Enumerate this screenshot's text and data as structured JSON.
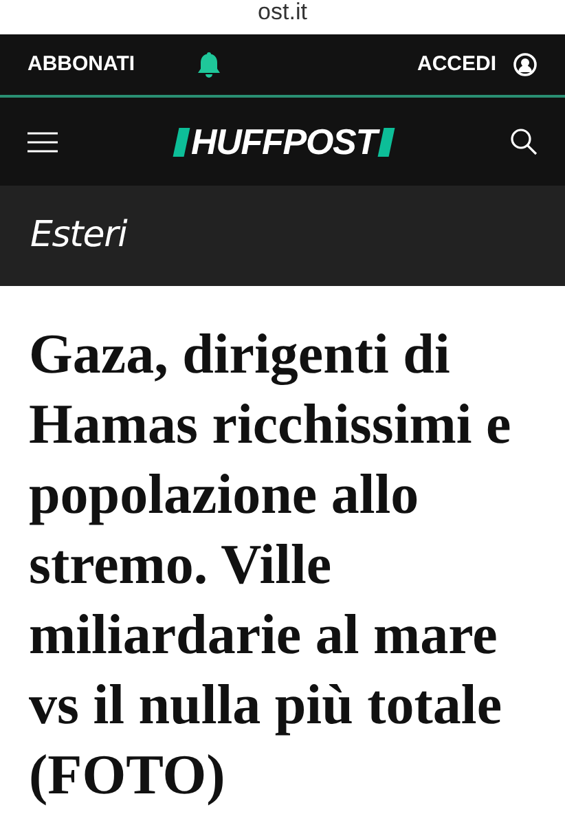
{
  "browser": {
    "url": "ost.it"
  },
  "top_bar": {
    "subscribe": "ABBONATI",
    "login": "ACCEDI"
  },
  "nav": {
    "logo": "HUFFPOST"
  },
  "section": {
    "title": "Esteri"
  },
  "article": {
    "headline": "Gaza, dirigenti di Hamas ricchissimi e popolazione allo stremo. Ville miliardarie al mare vs il nulla più totale (FOTO)"
  }
}
